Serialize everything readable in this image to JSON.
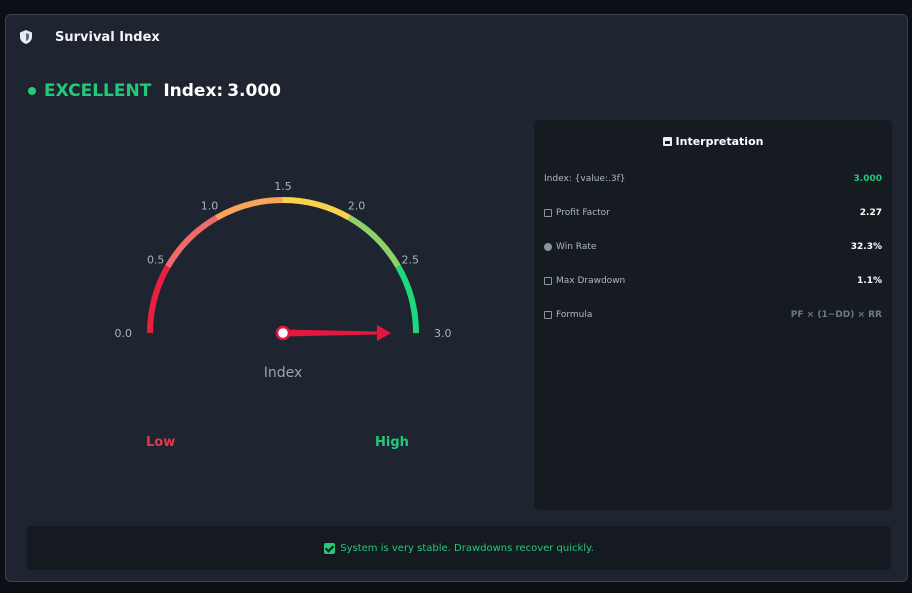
{
  "panel": {
    "title": "Survival Index",
    "icon": "shield-icon"
  },
  "status": {
    "label": "EXCELLENT",
    "index_label": "Index:",
    "index_value": "3.000",
    "color": "#22c97a"
  },
  "gauge": {
    "value": 3.0,
    "min": 0,
    "max": 3,
    "center_label": "Index",
    "ticks": [
      "0.0",
      "0.5",
      "1.0",
      "1.5",
      "2.0",
      "2.5",
      "3.0"
    ],
    "segment_colors": [
      "#e8203f",
      "#f06a6a",
      "#f9a45a",
      "#f8d24a",
      "#8fd16b",
      "#1ed87e"
    ],
    "low_label": "Low",
    "high_label": "High",
    "needle_color": "#e5173f"
  },
  "interpretation": {
    "title": "Interpretation",
    "rows": [
      {
        "label": "Index: {value:.3f}",
        "value": "3.000",
        "icon": "",
        "style": "green"
      },
      {
        "label": "Profit Factor",
        "value": "2.27",
        "icon": "bar-chart-icon",
        "style": "normal"
      },
      {
        "label": "Win Rate",
        "value": "32.3%",
        "icon": "target-icon",
        "style": "normal"
      },
      {
        "label": "Max Drawdown",
        "value": "1.1%",
        "icon": "chart-down-icon",
        "style": "normal"
      },
      {
        "label": "Formula",
        "value": "PF × (1−DD) × RR",
        "icon": "ruler-icon",
        "style": "muted"
      }
    ]
  },
  "footer": {
    "message": "System is very stable. Drawdowns recover quickly.",
    "icon": "checkmark-icon"
  }
}
